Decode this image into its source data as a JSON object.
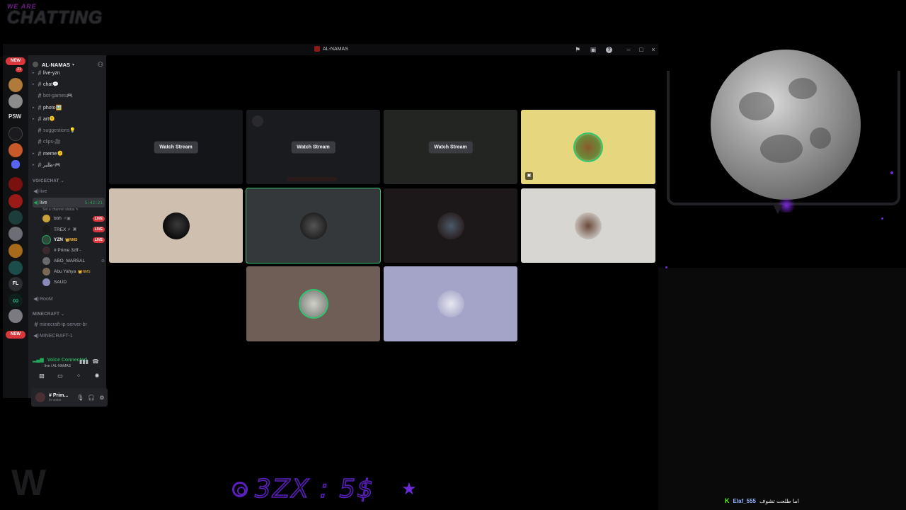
{
  "overlay": {
    "brand_top": "WE ARE",
    "brand_main": "CHATTING",
    "price_text": "3ZX : 5$"
  },
  "window": {
    "title": "AL-NAMAS"
  },
  "rail": {
    "new_top": "NEW",
    "new_bottom": "NEW",
    "badge_count": "21",
    "psw_label": "PSW",
    "fl_label": "FL"
  },
  "sidebar": {
    "server_name": "AL-NAMAS",
    "channels": [
      {
        "name": "live-yzn",
        "muted": false
      },
      {
        "name": "chat💬",
        "muted": false
      },
      {
        "name": "bot-games🎮",
        "muted": true
      },
      {
        "name": "photo🖼️",
        "muted": false
      },
      {
        "name": "art🫠",
        "muted": false
      },
      {
        "name": "suggestions💡",
        "muted": true
      },
      {
        "name": "clips-🎥",
        "muted": true
      },
      {
        "name": "meme🫠",
        "muted": false
      },
      {
        "name": "طلبر-🎮",
        "muted": false
      }
    ],
    "voice_category": "VOICECHAT",
    "voice_live_muted": "live",
    "voice_live_selected": "live",
    "voice_timer": "5:42:21",
    "channel_status": "Set a channel status",
    "voice_users": [
      {
        "name": "bbh",
        "live": true,
        "tag": ""
      },
      {
        "name": "TREX ⚡",
        "live": true,
        "tag": ""
      },
      {
        "name": "YZN",
        "live": true,
        "tag": "NMS"
      },
      {
        "name": "# Prime 3zff -",
        "live": false,
        "tag": ""
      },
      {
        "name": "ABO_MARSAL",
        "live": false,
        "tag": ""
      },
      {
        "name": "Abu Yahya",
        "live": false,
        "tag": "NMS"
      },
      {
        "name": "SAUD",
        "live": false,
        "tag": ""
      }
    ],
    "live_label": "LIVE",
    "room": "RooM",
    "minecraft_category": "MINECRAFT",
    "minecraft_channels": [
      "minecraft-ip-server-br",
      "MINECRAFT-1"
    ]
  },
  "voice_panel": {
    "status": "Voice Connected",
    "location": "live / AL-NAMAS"
  },
  "user_panel": {
    "name": "# Prim...",
    "status": "In voice"
  },
  "grid": {
    "watch_label": "Watch Stream"
  },
  "chat": {
    "badge": "K",
    "user": "Elaf_555",
    "message": "اما طلعت تشوف"
  }
}
